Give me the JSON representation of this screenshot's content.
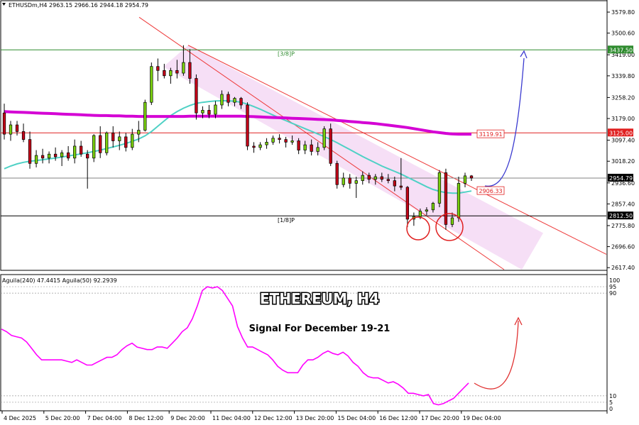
{
  "header": {
    "symbol_line": "ETHUSDm,H4  2963.15 2966.16 2944.18 2954.79"
  },
  "overlay": {
    "title": "ETHEREUM, H4",
    "subtitle": "Signal For December 19-21"
  },
  "indicator": {
    "header": "Aguila(240) 47.4415  Aguila(50) 92.2939",
    "ticks": [
      "100",
      "95",
      "90",
      "10",
      "5",
      "0"
    ],
    "range": [
      0,
      100
    ],
    "levels": [
      95,
      90,
      10,
      5
    ]
  },
  "price_axis": {
    "ticks": [
      "3579.80",
      "3500.60",
      "3419.00",
      "3339.80",
      "3258.20",
      "3179.00",
      "3097.40",
      "3018.20",
      "2936.60",
      "2857.40",
      "2775.80",
      "2696.60",
      "2617.40"
    ],
    "ylim": [
      2610,
      3620
    ]
  },
  "time_axis": {
    "labels": [
      "4 Dec 2025",
      "5 Dec 20:00",
      "7 Dec 04:00",
      "8 Dec 12:00",
      "9 Dec 20:00",
      "11 Dec 04:00",
      "12 Dec 12:00",
      "13 Dec 20:00",
      "15 Dec 04:00",
      "16 Dec 12:00",
      "17 Dec 20:00",
      "19 Dec 04:00"
    ]
  },
  "levels": [
    {
      "price": 3437.5,
      "label": "3437.50",
      "text": "[3/8]P",
      "color": "#2e8b2e"
    },
    {
      "price": 3125.0,
      "label": "3125.00",
      "text": "",
      "color": "#e02020"
    },
    {
      "price": 2812.5,
      "label": "2812.50",
      "text": "[1/8]P",
      "color": "#000000"
    },
    {
      "price": 2954.79,
      "label": "2954.79",
      "text": "",
      "color": "#808080"
    }
  ],
  "price_tags": [
    {
      "price": 3119.91,
      "label": "3119.91"
    },
    {
      "price": 2906.33,
      "label": "2906.33"
    }
  ],
  "colors": {
    "bull": "#7ad10e",
    "bear": "#c40018",
    "channel_fill": "#f3d4f3",
    "channel_line": "#ee3a3a",
    "ma_fast": "#4fd1c5",
    "ma_slow": "#d400d4",
    "indicator": "#ff00ff"
  },
  "chart_data": {
    "type": "candlestick",
    "title": "ETHEREUM, H4",
    "subtitle": "Signal For December 19-21",
    "symbol": "ETHUSDm",
    "timeframe": "H4",
    "ylim": [
      2610,
      3620
    ],
    "ohlc": [
      [
        3200,
        3235,
        3100,
        3120
      ],
      [
        3120,
        3170,
        3095,
        3155
      ],
      [
        3155,
        3170,
        3115,
        3130
      ],
      [
        3130,
        3160,
        3090,
        3100
      ],
      [
        3100,
        3130,
        2990,
        3010
      ],
      [
        3010,
        3060,
        2995,
        3040
      ],
      [
        3040,
        3065,
        3010,
        3030
      ],
      [
        3030,
        3055,
        3010,
        3045
      ],
      [
        3045,
        3070,
        3020,
        3035
      ],
      [
        3035,
        3060,
        3000,
        3050
      ],
      [
        3050,
        3075,
        3020,
        3030
      ],
      [
        3030,
        3100,
        3010,
        3075
      ],
      [
        3075,
        3095,
        3035,
        3045
      ],
      [
        3045,
        3060,
        2915,
        3030
      ],
      [
        3030,
        3120,
        3015,
        3115
      ],
      [
        3115,
        3150,
        3030,
        3050
      ],
      [
        3050,
        3130,
        3040,
        3125
      ],
      [
        3125,
        3150,
        3070,
        3095
      ],
      [
        3095,
        3130,
        3060,
        3110
      ],
      [
        3110,
        3125,
        3055,
        3070
      ],
      [
        3070,
        3140,
        3060,
        3120
      ],
      [
        3120,
        3170,
        3090,
        3135
      ],
      [
        3135,
        3250,
        3130,
        3240
      ],
      [
        3240,
        3390,
        3230,
        3375
      ],
      [
        3375,
        3405,
        3320,
        3360
      ],
      [
        3360,
        3385,
        3330,
        3340
      ],
      [
        3340,
        3370,
        3310,
        3360
      ],
      [
        3360,
        3400,
        3330,
        3350
      ],
      [
        3350,
        3455,
        3340,
        3390
      ],
      [
        3390,
        3440,
        3310,
        3330
      ],
      [
        3330,
        3345,
        3175,
        3200
      ],
      [
        3200,
        3225,
        3180,
        3210
      ],
      [
        3210,
        3230,
        3180,
        3195
      ],
      [
        3195,
        3245,
        3180,
        3230
      ],
      [
        3230,
        3285,
        3215,
        3270
      ],
      [
        3270,
        3280,
        3225,
        3240
      ],
      [
        3240,
        3260,
        3225,
        3255
      ],
      [
        3255,
        3260,
        3215,
        3230
      ],
      [
        3230,
        3240,
        3060,
        3075
      ],
      [
        3075,
        3090,
        3050,
        3070
      ],
      [
        3070,
        3090,
        3060,
        3080
      ],
      [
        3080,
        3105,
        3065,
        3090
      ],
      [
        3090,
        3115,
        3080,
        3105
      ],
      [
        3105,
        3120,
        3085,
        3100
      ],
      [
        3100,
        3110,
        3070,
        3090
      ],
      [
        3090,
        3115,
        3080,
        3095
      ],
      [
        3095,
        3105,
        3045,
        3060
      ],
      [
        3060,
        3095,
        3045,
        3080
      ],
      [
        3080,
        3100,
        3040,
        3055
      ],
      [
        3055,
        3090,
        3040,
        3070
      ],
      [
        3070,
        3150,
        3060,
        3140
      ],
      [
        3140,
        3160,
        3000,
        3010
      ],
      [
        3010,
        3020,
        2915,
        2930
      ],
      [
        2930,
        2975,
        2920,
        2955
      ],
      [
        2955,
        2970,
        2915,
        2935
      ],
      [
        2935,
        2960,
        2880,
        2945
      ],
      [
        2945,
        2980,
        2930,
        2965
      ],
      [
        2965,
        2975,
        2935,
        2950
      ],
      [
        2950,
        2970,
        2930,
        2960
      ],
      [
        2960,
        2975,
        2940,
        2950
      ],
      [
        2950,
        2970,
        2935,
        2945
      ],
      [
        2945,
        2960,
        2905,
        2925
      ],
      [
        2925,
        3030,
        2910,
        2920
      ],
      [
        2920,
        2925,
        2770,
        2800
      ],
      [
        2800,
        2825,
        2775,
        2810
      ],
      [
        2810,
        2840,
        2800,
        2830
      ],
      [
        2830,
        2845,
        2815,
        2835
      ],
      [
        2835,
        2865,
        2825,
        2860
      ],
      [
        2860,
        2985,
        2845,
        2975
      ],
      [
        2975,
        2990,
        2760,
        2780
      ],
      [
        2780,
        2825,
        2770,
        2805
      ],
      [
        2805,
        2960,
        2790,
        2935
      ],
      [
        2935,
        2975,
        2920,
        2963
      ],
      [
        2963,
        2966,
        2944,
        2955
      ]
    ],
    "moving_averages": {
      "fast": [
        2990,
        3000,
        3008,
        3014,
        3018,
        3021,
        3024,
        3027,
        3030,
        3034,
        3038,
        3042,
        3046,
        3050,
        3055,
        3060,
        3066,
        3072,
        3078,
        3085,
        3093,
        3102,
        3114,
        3130,
        3150,
        3170,
        3190,
        3205,
        3218,
        3228,
        3236,
        3240,
        3243,
        3245,
        3246,
        3246,
        3244,
        3240,
        3233,
        3224,
        3214,
        3203,
        3192,
        3181,
        3171,
        3161,
        3151,
        3141,
        3131,
        3121,
        3111,
        3100,
        3088,
        3075,
        3062,
        3049,
        3036,
        3024,
        3012,
        3000,
        2990,
        2980,
        2970,
        2958,
        2946,
        2934,
        2922,
        2912,
        2905,
        2900,
        2898,
        2898,
        2902,
        2906
      ],
      "slow": [
        3205,
        3204,
        3203,
        3202,
        3201,
        3200,
        3199,
        3198,
        3197,
        3196,
        3195,
        3194,
        3193,
        3192,
        3191,
        3190,
        3190,
        3189,
        3189,
        3188,
        3188,
        3187,
        3187,
        3187,
        3187,
        3187,
        3187,
        3187,
        3187,
        3188,
        3188,
        3188,
        3188,
        3188,
        3188,
        3188,
        3188,
        3188,
        3187,
        3186,
        3185,
        3184,
        3183,
        3182,
        3181,
        3180,
        3179,
        3178,
        3177,
        3176,
        3175,
        3174,
        3172,
        3170,
        3168,
        3166,
        3164,
        3162,
        3160,
        3157,
        3154,
        3151,
        3148,
        3145,
        3141,
        3137,
        3133,
        3129,
        3126,
        3123,
        3121,
        3120,
        3120,
        3120
      ]
    },
    "indicator": {
      "name": "Aguila",
      "values": [
        62,
        60,
        57,
        56,
        55,
        52,
        47,
        42,
        38,
        38,
        38,
        38,
        38,
        37,
        36,
        38,
        36,
        34,
        34,
        36,
        38,
        40,
        40,
        42,
        46,
        49,
        51,
        48,
        47,
        46,
        46,
        48,
        48,
        47,
        51,
        55,
        60,
        63,
        70,
        80,
        92,
        95,
        94,
        95,
        92,
        86,
        80,
        64,
        55,
        48,
        48,
        46,
        44,
        42,
        38,
        33,
        30,
        28,
        28,
        28,
        34,
        38,
        38,
        40,
        43,
        45,
        43,
        42,
        44,
        41,
        36,
        33,
        28,
        25,
        24,
        24,
        22,
        20,
        21,
        19,
        16,
        12,
        12,
        11,
        10,
        11,
        4,
        3,
        4,
        6,
        8,
        12,
        16,
        20
      ]
    },
    "levels": [
      3437.5,
      3125.0,
      2812.5,
      2954.79
    ],
    "tags": [
      3119.91,
      2906.33
    ],
    "channel": {
      "upper": {
        "start_price": 3455,
        "end_price": 2908
      },
      "lower": {
        "start_price": 3320,
        "end_price": 2735
      }
    },
    "xlabel": "",
    "ylabel": ""
  }
}
